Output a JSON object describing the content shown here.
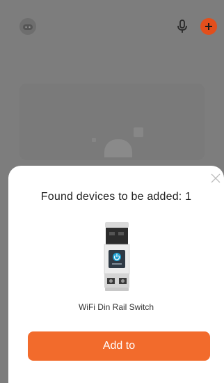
{
  "header": {
    "home_icon": "home-icon",
    "mic_icon": "microphone-icon",
    "add_icon": "plus-circle-icon"
  },
  "dialog": {
    "title": "Found devices to be added: 1",
    "close_icon": "close-icon",
    "device": {
      "name": "WiFi Din Rail Switch",
      "image_icon": "din-rail-switch-device-image"
    },
    "primary_button_label": "Add to"
  },
  "colors": {
    "accent": "#f26b2c",
    "add_icon_bg": "#e24f1c",
    "backdrop": "#7d7d7d"
  }
}
